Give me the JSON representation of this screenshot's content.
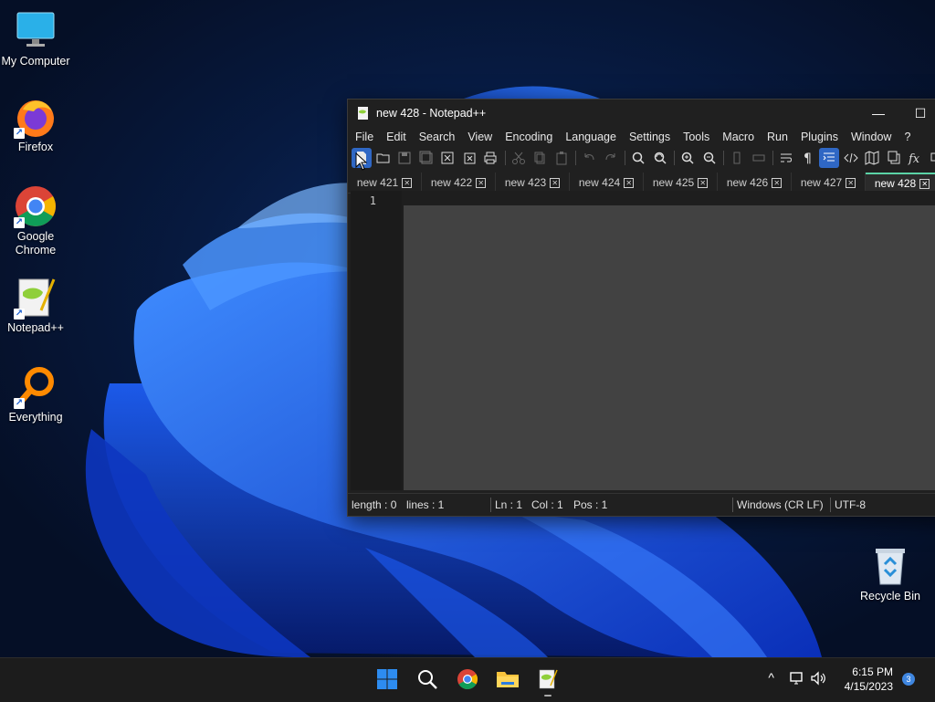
{
  "desktop": {
    "icons": [
      {
        "label": "My Computer",
        "icon": "computer-icon"
      },
      {
        "label": "Firefox",
        "icon": "firefox-icon"
      },
      {
        "label": "Google Chrome",
        "icon": "chrome-icon"
      },
      {
        "label": "Notepad++",
        "icon": "notepadpp-icon"
      },
      {
        "label": "Everything",
        "icon": "everything-search-icon"
      },
      {
        "label": "Recycle Bin",
        "icon": "recycle-bin-icon"
      }
    ]
  },
  "window": {
    "title": "new 428 - Notepad++",
    "minimize": "—",
    "maximize": "☐",
    "menu": [
      "File",
      "Edit",
      "Search",
      "View",
      "Encoding",
      "Language",
      "Settings",
      "Tools",
      "Macro",
      "Run",
      "Plugins",
      "Window",
      "?",
      "+"
    ],
    "tabs": [
      {
        "label": "new 421",
        "active": false
      },
      {
        "label": "new 422",
        "active": false
      },
      {
        "label": "new 423",
        "active": false
      },
      {
        "label": "new 424",
        "active": false
      },
      {
        "label": "new 425",
        "active": false
      },
      {
        "label": "new 426",
        "active": false
      },
      {
        "label": "new 427",
        "active": false
      },
      {
        "label": "new 428",
        "active": true
      }
    ],
    "tab_close": "✕",
    "line_number": "1",
    "status": {
      "length": "length : 0",
      "lines": "lines : 1",
      "ln": "Ln : 1",
      "col": "Col : 1",
      "pos": "Pos : 1",
      "eol": "Windows (CR LF)",
      "encoding": "UTF-8"
    }
  },
  "taskbar": {
    "time": "6:15 PM",
    "date": "4/15/2023",
    "notification_count": "3",
    "tray_chevron": "^"
  },
  "colors": {
    "accent": "#2f67c4",
    "active_tab_marker": "#5bd3a6",
    "window_bg": "#202020",
    "editor_bg": "#424242"
  }
}
